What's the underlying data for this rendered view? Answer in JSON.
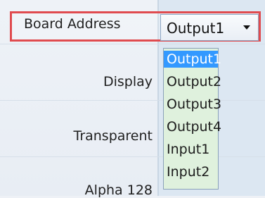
{
  "property_grid": {
    "rows": [
      {
        "label": "Board Address"
      },
      {
        "label": "Display"
      },
      {
        "label": "Transparent"
      },
      {
        "label": "Alpha 128"
      }
    ]
  },
  "board_address_select": {
    "value": "Output1",
    "options": [
      "Output1",
      "Output2",
      "Output3",
      "Output4",
      "Input1",
      "Input2"
    ],
    "selected_index": 0
  },
  "colors": {
    "highlight_border": "#e04b4f",
    "dropdown_background": "#dff1dd",
    "selected_item": "#3399ff",
    "value_column": "#dce7f2"
  }
}
